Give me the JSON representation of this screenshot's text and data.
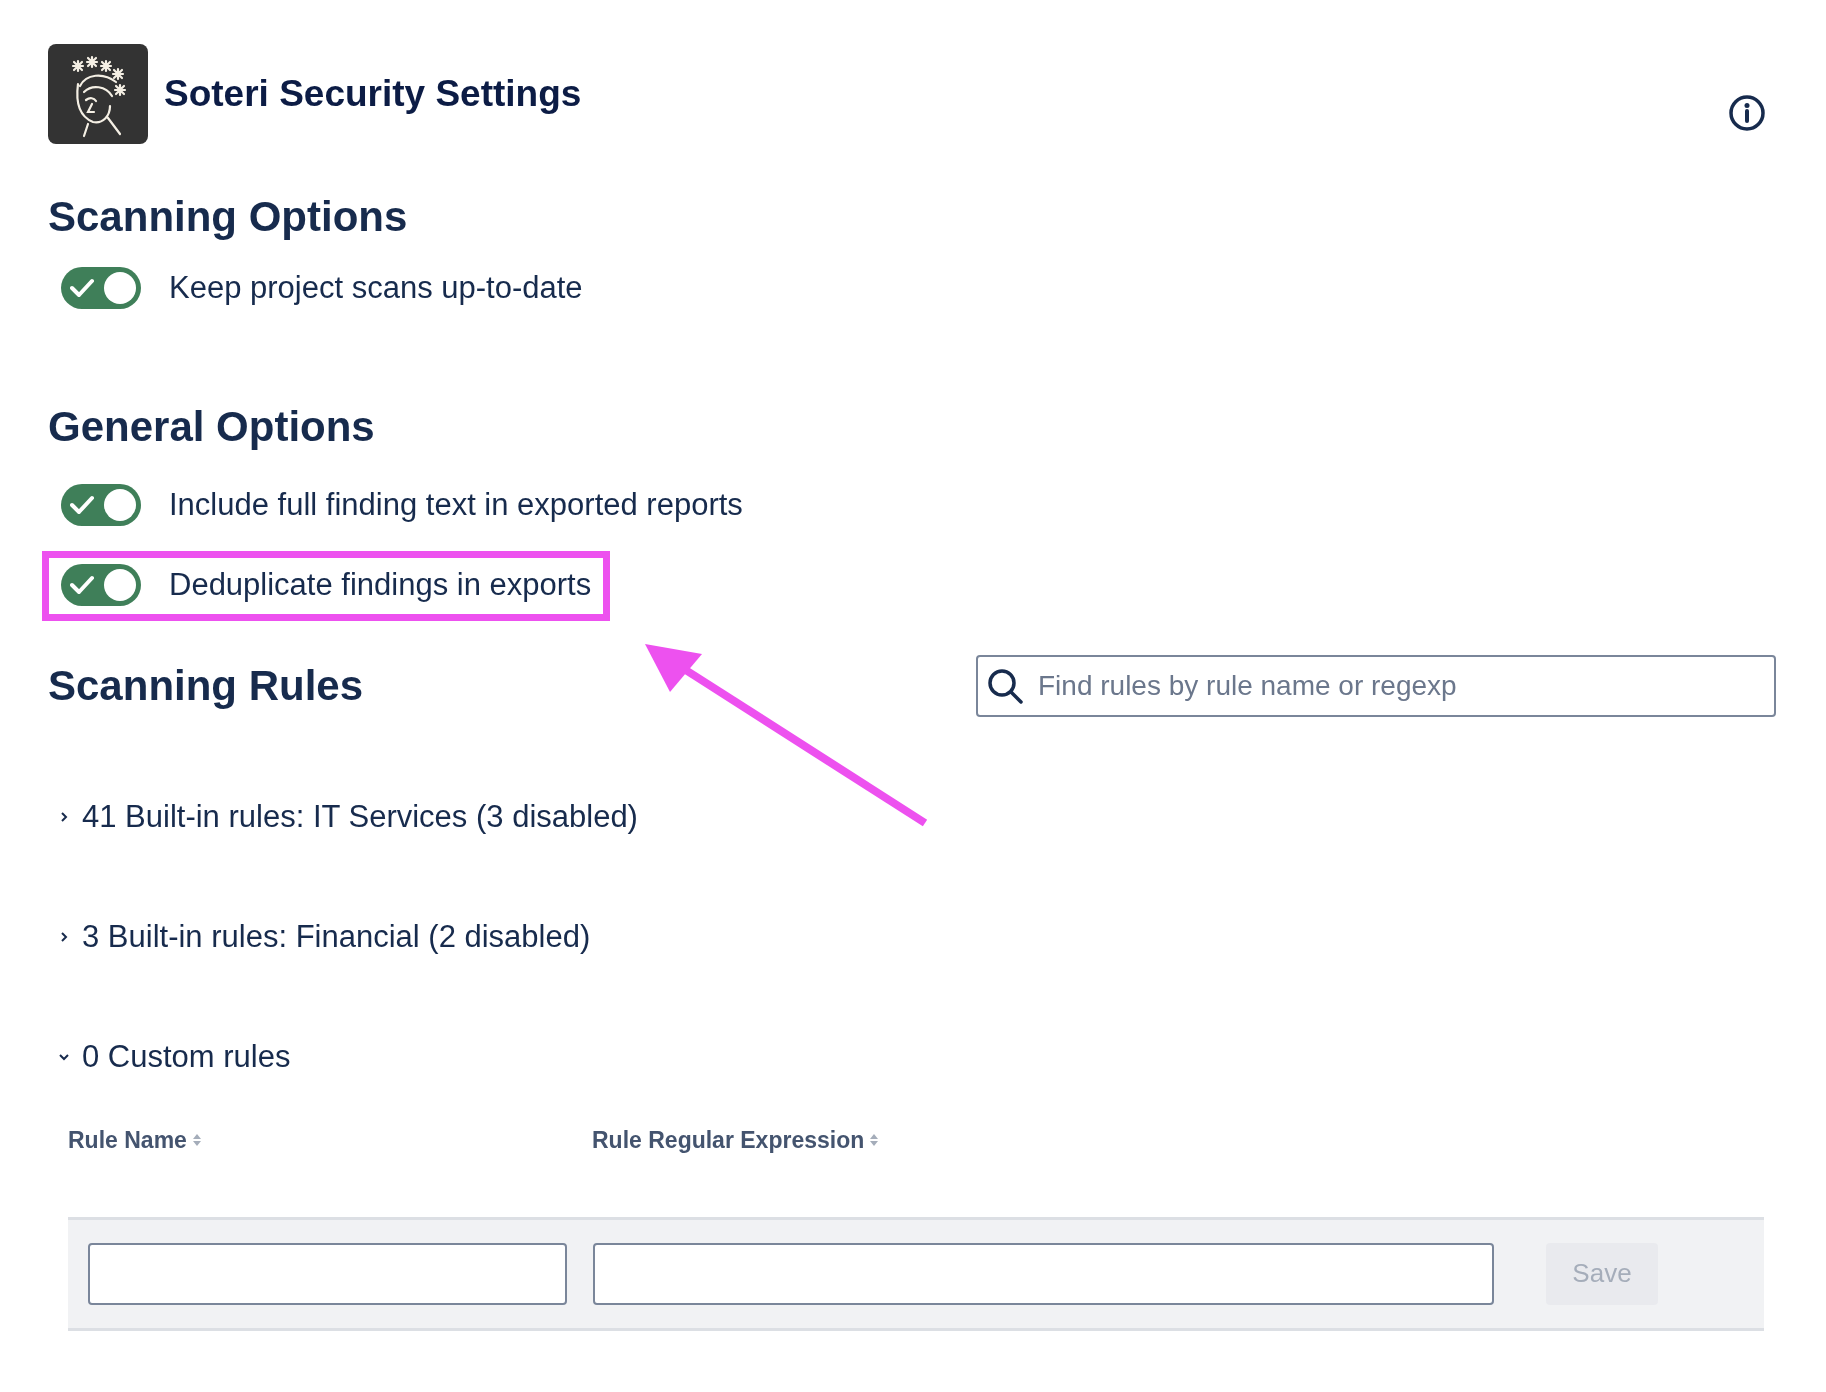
{
  "header": {
    "title": "Soteri Security Settings"
  },
  "scanning_options": {
    "title": "Scanning Options",
    "toggles": [
      {
        "label": "Keep project scans up-to-date",
        "on": true,
        "highlighted": false
      }
    ]
  },
  "general_options": {
    "title": "General Options",
    "toggles": [
      {
        "label": "Include full finding text in exported reports",
        "on": true,
        "highlighted": false
      },
      {
        "label": "Deduplicate findings in exports",
        "on": true,
        "highlighted": true
      }
    ]
  },
  "scanning_rules": {
    "title": "Scanning Rules",
    "search": {
      "placeholder": "Find rules by rule name or regexp"
    },
    "groups": [
      {
        "label": "41 Built-in rules: IT Services (3 disabled)",
        "expanded": false
      },
      {
        "label": "3 Built-in rules: Financial (2 disabled)",
        "expanded": false
      },
      {
        "label": "0 Custom rules",
        "expanded": true
      }
    ],
    "table": {
      "columns": [
        "Rule Name",
        "Rule Regular Expression"
      ],
      "save_button": {
        "label": "Save",
        "disabled": true
      }
    }
  }
}
